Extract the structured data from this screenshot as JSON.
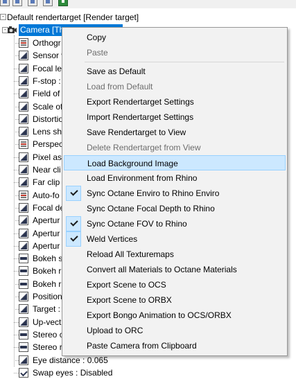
{
  "toolbar": {
    "buttons": [
      "toolbar-button",
      "toolbar-button",
      "toolbar-button",
      "toolbar-button",
      "toolbar-button"
    ]
  },
  "tree": {
    "root": {
      "expander": "-",
      "label": "Default rendertarget  [Render target]"
    },
    "camera": {
      "expander": "-",
      "label": "Camera  [Th"
    },
    "items": [
      {
        "label": "Orthogr",
        "icon": "enum"
      },
      {
        "label": "Sensor w",
        "icon": "slider"
      },
      {
        "label": "Focal le",
        "icon": "slider"
      },
      {
        "label": "F-stop :",
        "icon": "slider"
      },
      {
        "label": "Field of",
        "icon": "slider"
      },
      {
        "label": "Scale of",
        "icon": "slider"
      },
      {
        "label": "Distortio",
        "icon": "slider"
      },
      {
        "label": "Lens shi",
        "icon": "slider"
      },
      {
        "label": "Perspec",
        "icon": "enum"
      },
      {
        "label": "Pixel asp",
        "icon": "slider"
      },
      {
        "label": "Near cli",
        "icon": "slider"
      },
      {
        "label": "Far clip",
        "icon": "slider"
      },
      {
        "label": "Auto-fo",
        "icon": "enum"
      },
      {
        "label": "Focal de",
        "icon": "slider"
      },
      {
        "label": "Apertur",
        "icon": "slider"
      },
      {
        "label": "Apertur",
        "icon": "slider"
      },
      {
        "label": "Apertur",
        "icon": "slider"
      },
      {
        "label": "Bokeh s",
        "icon": "bar"
      },
      {
        "label": "Bokeh r",
        "icon": "bar"
      },
      {
        "label": "Bokeh r",
        "icon": "bar"
      },
      {
        "label": "Position",
        "icon": "slider"
      },
      {
        "label": "Target :",
        "icon": "slider"
      },
      {
        "label": "Up-vect",
        "icon": "slider"
      },
      {
        "label": "Stereo c",
        "icon": "bar"
      },
      {
        "label": "Stereo r",
        "icon": "bar"
      },
      {
        "label": "Eye distance : 0.065",
        "icon": "slider"
      },
      {
        "label": "Swap eyes : Disabled",
        "icon": "check"
      }
    ]
  },
  "context_menu": {
    "items": [
      {
        "label": "Copy",
        "disabled": false,
        "checked": false,
        "hover": false
      },
      {
        "label": "Paste",
        "disabled": true,
        "checked": false,
        "hover": false
      },
      {
        "separator": true
      },
      {
        "label": "Save as Default",
        "disabled": false,
        "checked": false,
        "hover": false
      },
      {
        "label": "Load from Default",
        "disabled": true,
        "checked": false,
        "hover": false
      },
      {
        "label": "Export Rendertarget Settings",
        "disabled": false,
        "checked": false,
        "hover": false
      },
      {
        "label": "Import Rendertarget Settings",
        "disabled": false,
        "checked": false,
        "hover": false
      },
      {
        "label": "Save Rendertarget to View",
        "disabled": false,
        "checked": false,
        "hover": false
      },
      {
        "label": "Delete Rendertarget from View",
        "disabled": true,
        "checked": false,
        "hover": false
      },
      {
        "label": "Load Background Image",
        "disabled": false,
        "checked": false,
        "hover": true
      },
      {
        "label": "Load Environment from Rhino",
        "disabled": false,
        "checked": false,
        "hover": false
      },
      {
        "label": "Sync Octane Enviro to Rhino Enviro",
        "disabled": false,
        "checked": true,
        "hover": false
      },
      {
        "label": "Sync Octane Focal Depth to Rhino",
        "disabled": false,
        "checked": false,
        "hover": false
      },
      {
        "label": "Sync Octane FOV to Rhino",
        "disabled": false,
        "checked": true,
        "hover": false
      },
      {
        "label": "Weld Vertices",
        "disabled": false,
        "checked": true,
        "hover": false
      },
      {
        "label": "Reload All Texturemaps",
        "disabled": false,
        "checked": false,
        "hover": false
      },
      {
        "label": "Convert all Materials to Octane Materials",
        "disabled": false,
        "checked": false,
        "hover": false
      },
      {
        "label": "Export Scene to OCS",
        "disabled": false,
        "checked": false,
        "hover": false
      },
      {
        "label": "Export Scene to ORBX",
        "disabled": false,
        "checked": false,
        "hover": false
      },
      {
        "label": "Export Bongo Animation to OCS/ORBX",
        "disabled": false,
        "checked": false,
        "hover": false
      },
      {
        "label": "Upload to ORC",
        "disabled": false,
        "checked": false,
        "hover": false
      },
      {
        "label": "Paste Camera from Clipboard",
        "disabled": false,
        "checked": false,
        "hover": false
      }
    ]
  }
}
